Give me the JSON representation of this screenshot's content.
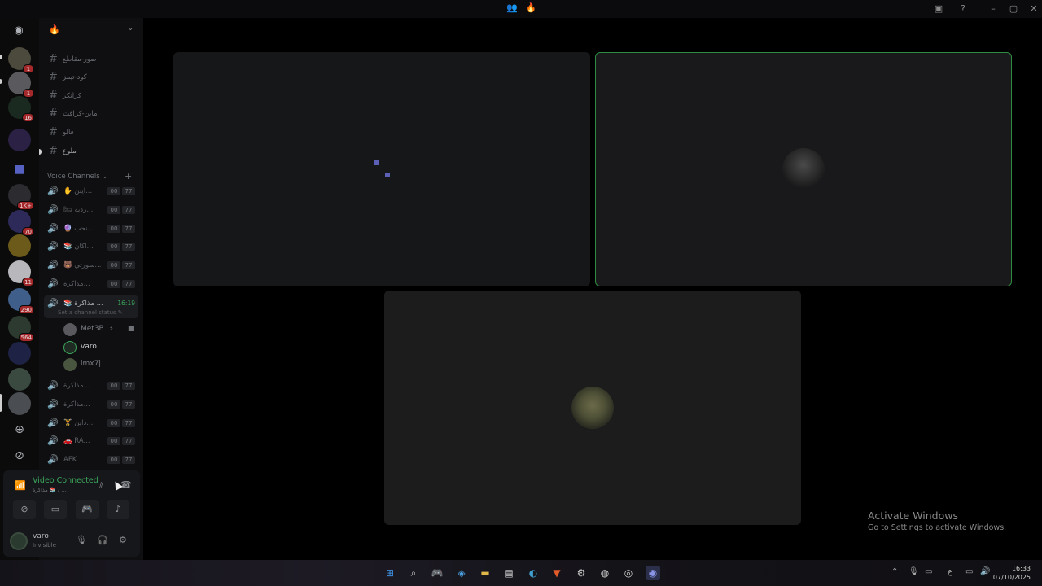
{
  "titlebar": {
    "center_icons": [
      "users-icon",
      "fire-icon"
    ],
    "controls": [
      "screen-share-icon",
      "help-icon",
      "minimize-icon",
      "maximize-icon",
      "close-icon"
    ]
  },
  "server": {
    "name_icon": "fire-icon"
  },
  "text_channels": [
    {
      "label": "صور-مقاطع"
    },
    {
      "label": "كود-تيمز"
    },
    {
      "label": "كرانكر"
    },
    {
      "label": "ماين-كرافت"
    },
    {
      "label": "فالو"
    },
    {
      "label": "ملوع"
    }
  ],
  "voice_category": "Voice Channels",
  "voice_channels": [
    {
      "label": "✋ اينن...",
      "a": "00",
      "b": "77"
    },
    {
      "label": "🛏 ردية...",
      "a": "00",
      "b": "77"
    },
    {
      "label": "🔮 نحب...",
      "a": "00",
      "b": "77"
    },
    {
      "label": "📚 اكان...",
      "a": "00",
      "b": "77"
    },
    {
      "label": "🐻 سورتي...",
      "a": "00",
      "b": "77"
    },
    {
      "label": "مذاكرة...",
      "a": "00",
      "b": "77"
    }
  ],
  "active_voice": {
    "label": "📚 مذاكرة ...",
    "time": "16:19",
    "status": "Set a channel status"
  },
  "members": [
    {
      "name": "Met3B"
    },
    {
      "name": "varo"
    },
    {
      "name": "imx7j"
    }
  ],
  "voice_channels_after": [
    {
      "label": "مذاكرة...",
      "a": "00",
      "b": "77"
    },
    {
      "label": "مذاكرة...",
      "a": "00",
      "b": "77"
    },
    {
      "label": "🏋 داين...",
      "a": "00",
      "b": "77"
    },
    {
      "label": "🚗 RA...",
      "a": "00",
      "b": "77"
    },
    {
      "label": "AFK",
      "a": "00",
      "b": "77"
    }
  ],
  "voice_panel": {
    "status": "Video Connected",
    "channel": "مذاكرة 📚 / ..."
  },
  "user": {
    "name": "varo",
    "status": "Invisible"
  },
  "guild_badges": [
    "1",
    "1",
    "16",
    "1K+",
    "70",
    "11",
    "290",
    "564"
  ],
  "activate_windows": {
    "title": "Activate Windows",
    "subtitle": "Go to Settings to activate Windows."
  },
  "clock": {
    "time": "16:33",
    "date": "07/10/2025"
  },
  "tray": {
    "lang": "ع"
  },
  "accent": {
    "green": "#3ba55c",
    "red_badge": "#a5292b",
    "speaking_border": "#2d8c3f"
  }
}
